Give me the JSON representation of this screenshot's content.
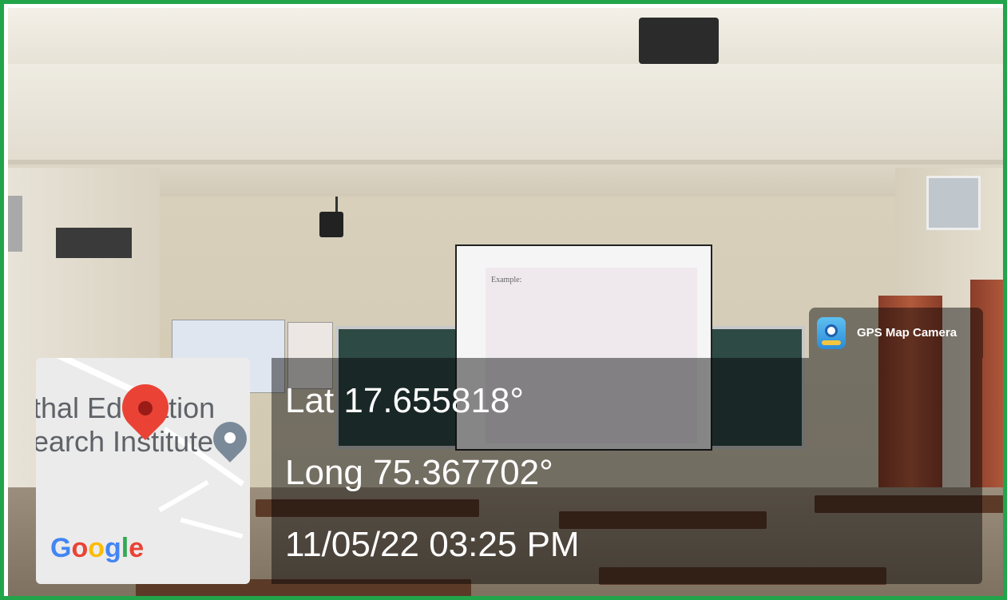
{
  "overlay": {
    "app_name": "GPS Map Camera",
    "lat": "Lat 17.655818°",
    "long": "Long 75.367702°",
    "datetime": "11/05/22 03:25 PM"
  },
  "map": {
    "label_line1": "thal Education",
    "label_line2": "earch Institute",
    "brand": [
      "G",
      "o",
      "o",
      "g",
      "l",
      "e"
    ]
  },
  "slide": {
    "title": "Example:"
  },
  "colors": {
    "border": "#22a54a",
    "pin": "#ea4335",
    "overlay": "rgba(0,0,0,0.45)"
  }
}
